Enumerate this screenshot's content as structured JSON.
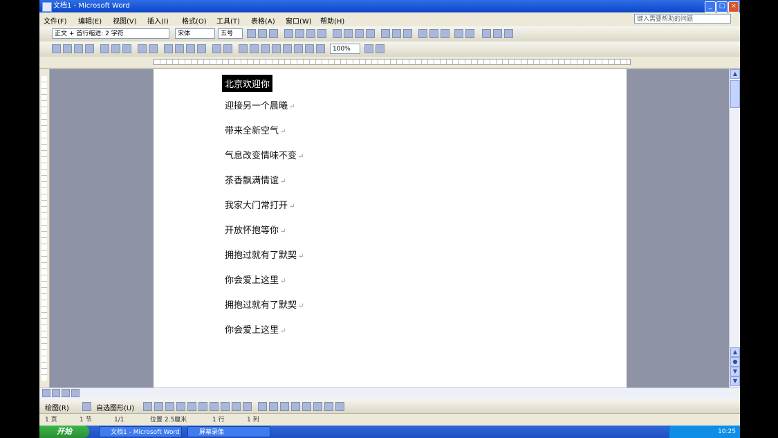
{
  "window": {
    "title": "文档1 - Microsoft Word"
  },
  "menubar": {
    "items": [
      "文件(F)",
      "编辑(E)",
      "视图(V)",
      "插入(I)",
      "格式(O)",
      "工具(T)",
      "表格(A)",
      "窗口(W)",
      "帮助(H)"
    ],
    "help_placeholder": "键入需要帮助的问题"
  },
  "toolbar": {
    "style_value": "正文 + 首行缩进: 2 字符",
    "font_value": "宋体",
    "size_value": "五号",
    "zoom_value": "100%"
  },
  "document": {
    "lines": [
      {
        "text": "北京欢迎你",
        "selected": true
      },
      {
        "text": "迎接另一个晨曦",
        "selected": false
      },
      {
        "text": "带来全新空气",
        "selected": false
      },
      {
        "text": "气息改变情味不变",
        "selected": false
      },
      {
        "text": "茶香飘满情谊",
        "selected": false
      },
      {
        "text": "我家大门常打开",
        "selected": false
      },
      {
        "text": "开放怀抱等你",
        "selected": false
      },
      {
        "text": "拥抱过就有了默契",
        "selected": false
      },
      {
        "text": "你会爱上这里",
        "selected": false
      },
      {
        "text": "拥抱过就有了默契",
        "selected": false
      },
      {
        "text": "你会爱上这里",
        "selected": false
      }
    ]
  },
  "drawbar": {
    "draw_label": "绘图(R)",
    "autoshapes_label": "自选图形(U)"
  },
  "statusbar": {
    "page": "1 页",
    "section": "1 节",
    "pages": "1/1",
    "position": "位置 2.5厘米",
    "line": "1 行",
    "col": "1 列"
  },
  "taskbar": {
    "start_label": "开始",
    "tasks": [
      "文档1 - Microsoft Word",
      "屏幕录像"
    ],
    "clock": "10:25"
  }
}
